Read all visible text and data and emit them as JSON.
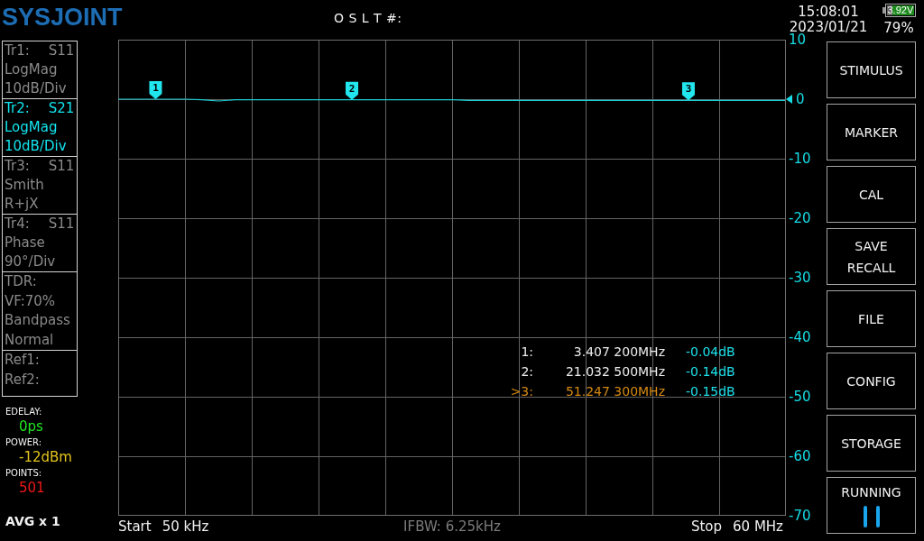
{
  "header": {
    "logo": "SYSJOINT",
    "cal_status": "O S L T #:",
    "time": "15:08:01",
    "date": "2023/01/21",
    "battery_voltage": "3.92V",
    "battery_percent": "79%"
  },
  "traces": [
    {
      "name": "Tr1:",
      "param": "S11",
      "format": "LogMag",
      "scale": "10dB/Div",
      "selected": false
    },
    {
      "name": "Tr2:",
      "param": "S21",
      "format": "LogMag",
      "scale": "10dB/Div",
      "selected": true
    },
    {
      "name": "Tr3:",
      "param": "S11",
      "format": "Smith",
      "scale": "R+jX",
      "selected": false
    },
    {
      "name": "Tr4:",
      "param": "S11",
      "format": "Phase",
      "scale": "90°/Div",
      "selected": false
    }
  ],
  "tdr": [
    "TDR:",
    "VF:70%",
    "Bandpass",
    "Normal"
  ],
  "references": [
    "Ref1:",
    "Ref2:"
  ],
  "settings": [
    {
      "label": "EDELAY:",
      "value": "0ps",
      "color": "#22e822"
    },
    {
      "label": "POWER:",
      "value": "-12dBm",
      "color": "#e2c41e"
    },
    {
      "label": "POINTS:",
      "value": "501",
      "color": "#f01818"
    }
  ],
  "averaging": "AVG x 1",
  "plot": {
    "chart_data": {
      "type": "line",
      "grid": true,
      "categories": [
        null,
        null,
        null,
        null,
        null,
        null,
        null,
        null,
        null,
        null,
        null,
        null,
        null,
        null,
        null,
        null,
        null,
        null,
        null,
        null,
        null,
        null,
        null,
        null,
        null,
        null,
        null,
        null,
        null,
        null,
        null,
        null,
        null,
        null,
        null,
        null,
        null,
        null,
        null,
        null,
        null
      ],
      "ylim": [
        -70,
        10
      ],
      "yticks": [
        {
          "value": 10,
          "label": "10"
        },
        {
          "value": 0,
          "label": "0"
        },
        {
          "value": -10,
          "label": "-10"
        },
        {
          "value": -20,
          "label": "-20"
        },
        {
          "value": -30,
          "label": "-30"
        },
        {
          "value": -40,
          "label": "-40"
        },
        {
          "value": -50,
          "label": "-50"
        },
        {
          "value": -60,
          "label": "-60"
        },
        {
          "value": -70,
          "label": "-70"
        }
      ],
      "series": [
        {
          "color": "#1ccdd4",
          "values": [
            0.0,
            0.0,
            0.0,
            0.0,
            0.0,
            -0.1,
            -0.3,
            -0.1,
            -0.1,
            -0.1,
            -0.1,
            -0.1,
            -0.1,
            -0.1,
            -0.1,
            -0.1,
            -0.1,
            -0.1,
            -0.1,
            -0.1,
            -0.1,
            -0.2,
            -0.2,
            -0.2,
            -0.2,
            -0.2,
            -0.2,
            -0.2,
            -0.2,
            -0.2,
            -0.2,
            -0.2,
            -0.2,
            -0.2,
            -0.2,
            -0.2,
            -0.2,
            -0.2,
            -0.2,
            -0.2,
            -0.2
          ]
        }
      ]
    },
    "reference_marker": {
      "level": 0.875
    },
    "markers": [
      {
        "label": "1",
        "level": 0.056
      },
      {
        "label": "2",
        "level": 0.35
      },
      {
        "label": "3",
        "level": 0.854
      }
    ],
    "marker_readout": [
      {
        "label": "1:",
        "frequency": "3.407 200MHz",
        "value": "-0.04dB",
        "selected": false
      },
      {
        "label": "2:",
        "frequency": "21.032 500MHz",
        "value": "-0.14dB",
        "selected": false
      },
      {
        "label": ">3:",
        "frequency": "51.247 300MHz",
        "value": "-0.15dB",
        "selected": true
      }
    ]
  },
  "sweep_bar": {
    "start_label": "Start",
    "start": "50 kHz",
    "ifbw": "IFBW: 6.25kHz",
    "stop_label": "Stop",
    "stop": "60 MHz"
  },
  "menu_buttons": [
    {
      "label": "STIMULUS",
      "kind": "menu"
    },
    {
      "label": "MARKER",
      "kind": "menu"
    },
    {
      "label": "CAL",
      "kind": "menu"
    },
    {
      "label": "SAVE\nRECALL",
      "kind": "menu"
    },
    {
      "label": "FILE",
      "kind": "menu"
    },
    {
      "label": "CONFIG",
      "kind": "menu"
    },
    {
      "label": "STORAGE",
      "kind": "menu"
    },
    {
      "label": "RUNNING",
      "kind": "run"
    }
  ]
}
